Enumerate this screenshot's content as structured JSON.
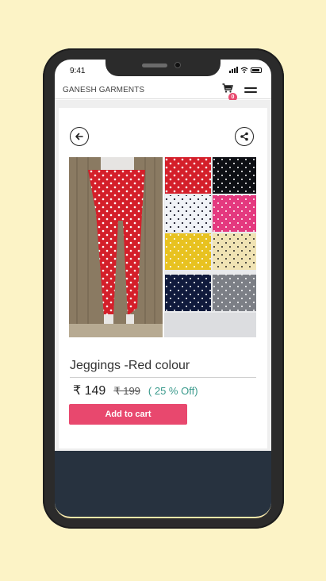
{
  "status_bar": {
    "time": "9:41"
  },
  "header": {
    "brand": "GANESH GARMENTS",
    "cart_count": "0"
  },
  "product": {
    "title": "Jeggings -Red colour",
    "price": "₹ 149",
    "old_price": "₹ 199",
    "discount": "( 25 % Off)",
    "add_to_cart_label": "Add to cart"
  },
  "colors": {
    "background": "#fcf3c6",
    "accent": "#e8486e",
    "discount": "#3a9a8c",
    "footer": "#27323f",
    "phone_frame": "#2b2b2b"
  },
  "icons": {
    "back": "arrow-left-icon",
    "share": "share-icon",
    "cart": "cart-icon",
    "menu": "hamburger-menu-icon"
  }
}
